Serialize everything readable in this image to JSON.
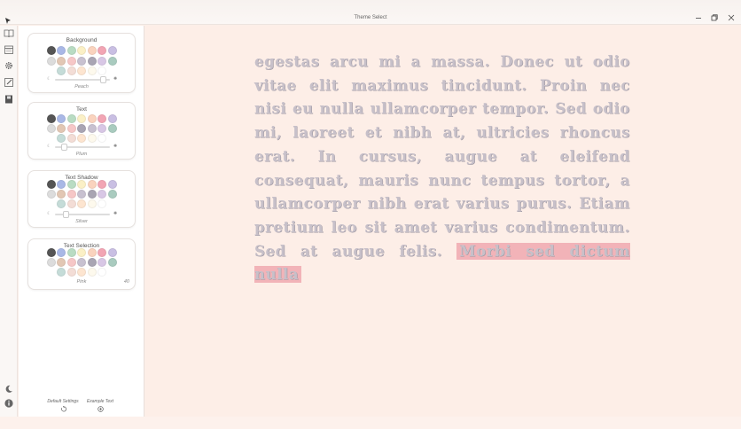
{
  "window": {
    "title": "Theme Select"
  },
  "rail": {
    "items": [
      "book-icon",
      "calendar-icon",
      "gear-icon",
      "edit-icon",
      "library-icon"
    ],
    "bottom": [
      "moon-icon",
      "info-icon"
    ]
  },
  "panels": {
    "background": {
      "title": "Background",
      "value": "Peach",
      "level": 0.93,
      "rows": [
        [
          "#555555",
          "#a9b8e6",
          "#b9dcc3",
          "#fbf0c6",
          "#fad3be",
          "#f2a5b4",
          "#c9bfe3"
        ],
        [
          "#dcdcdc",
          "#e2c7b4",
          "#f6c7c7",
          "#c8c1d0",
          "#a9a5b3",
          "#d8c7e5",
          "#a9cbbf"
        ],
        [
          "#c5dcd8",
          "#f3ddd6",
          "#fde5d0",
          "#fdf9ed",
          "#ffffff"
        ]
      ]
    },
    "text": {
      "title": "Text",
      "value": "Plum",
      "level": 0.12,
      "rows": [
        [
          "#555555",
          "#a9b8e6",
          "#b9dcc3",
          "#fbf0c6",
          "#fad3be",
          "#f2a5b4",
          "#c9bfe3"
        ],
        [
          "#dcdcdc",
          "#e2c7b4",
          "#f6c7c7",
          "#a9a5b3",
          "#c8c1d0",
          "#d8c7e5",
          "#a9cbbf"
        ],
        [
          "#c5dcd8",
          "#f3ddd6",
          "#fde5d0",
          "#fdf9ed",
          "#ffffff"
        ]
      ]
    },
    "text_shadow": {
      "title": "Text Shadow",
      "value": "Silver",
      "level": 0.17,
      "rows": [
        [
          "#555555",
          "#a9b8e6",
          "#b9dcc3",
          "#fbf0c6",
          "#fad3be",
          "#f2a5b4",
          "#c9bfe3"
        ],
        [
          "#dcdcdc",
          "#e2c7b4",
          "#f6c7c7",
          "#c8c1d0",
          "#a9a5b3",
          "#d8c7e5",
          "#a9cbbf"
        ],
        [
          "#c5dcd8",
          "#f3ddd6",
          "#fde5d0",
          "#fdf9ed",
          "#ffffff"
        ]
      ]
    },
    "text_selection": {
      "title": "Text Selection",
      "value": "Pink",
      "value_right": "40",
      "rows": [
        [
          "#555555",
          "#a9b8e6",
          "#b9dcc3",
          "#fbf0c6",
          "#fad3be",
          "#f2a5b4",
          "#c9bfe3"
        ],
        [
          "#dcdcdc",
          "#e2c7b4",
          "#f6c7c7",
          "#c8c1d0",
          "#a9a5b3",
          "#d8c7e5",
          "#a9cbbf"
        ],
        [
          "#c5dcd8",
          "#f3ddd6",
          "#fde5d0",
          "#fdf9ed",
          "#ffffff"
        ]
      ]
    }
  },
  "footer": {
    "default_settings": "Default Settings",
    "example_text": "Example Text"
  },
  "reading": {
    "text": "egestas arcu mi a massa. Donec ut odio vitae elit maximus tincidunt. Proin nec nisi eu nulla ullamcorper tempor. Sed odio mi, laoreet et nibh at, ultricies rhoncus erat. In cursus, augue at eleifend consequat, mauris nunc tempus tortor, a ullamcorper nibh erat varius purus. Etiam pretium leo sit amet varius condimentum. Sed at augue felis.",
    "selected": "Morbi sed dictum nulla"
  },
  "colors": {
    "reader_bg": "#fdeee7",
    "text": "#c7c0c9",
    "selection": "#f2b3b8"
  }
}
